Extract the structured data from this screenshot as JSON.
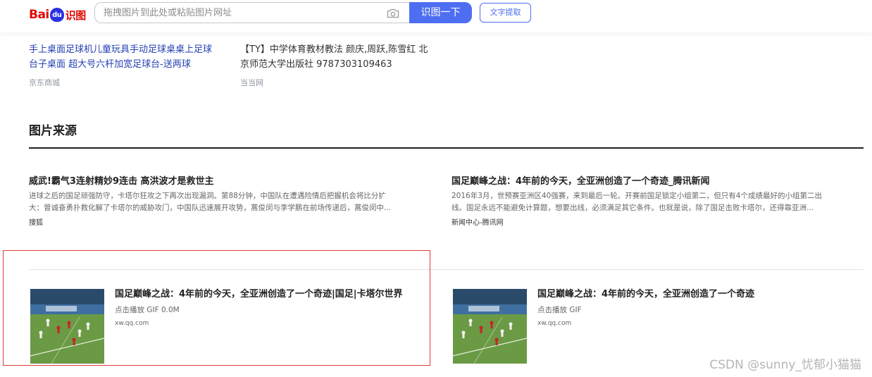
{
  "header": {
    "logo_bai": "Bai",
    "logo_du": "du",
    "logo_shitu": "识图",
    "search_placeholder": "拖拽图片到此处或粘贴图片网址",
    "search_button": "识图一下",
    "ocr_button": "文字提取"
  },
  "shopping": [
    {
      "title_line1": "手上桌面足球机儿童玩具手动足球桌桌上足球",
      "title_line2": "台子桌面 超大号六杆加宽足球台-送两球",
      "source": "京东商城"
    },
    {
      "title_line1": "【TY】中学体育教材教法 颜庆,周跃,陈雪红 北",
      "title_line2": "京师范大学出版社 9787303109463",
      "source": "当当网"
    }
  ],
  "section": {
    "title": "图片来源"
  },
  "text_results": [
    {
      "title": "威武!霸气3连射精妙9连击 高洪波才是救世主",
      "desc_line1": "进球之后的国足顽强防守，卡塔尔狂攻之下再次出现漏洞。第88分钟，中国队在遭遇险情后把握机会将比分扩",
      "desc_line2": "大：曾诚奋勇扑救化解了卡塔尔的威胁攻门，中国队迅速展开攻势，蒿俊闵与李学鹏在前场传递后，蒿俊闵中...",
      "source": "搜狐"
    },
    {
      "title": "国足巅峰之战：4年前的今天，全亚洲创造了一个奇迹_腾讯新闻",
      "desc_line1": "2016年3月，世预赛亚洲区40强赛，来到最后一轮。开赛前国足锁定小组第二，但只有4个成绩最好的小组第二出",
      "desc_line2": "线。国足永远不能避免计算题，想要出线，必须满足其它条件。也就是说，除了国足击败卡塔尔，还得靠亚洲...",
      "source": "新闻中心-腾讯网"
    }
  ],
  "image_results": [
    {
      "title": "国足巅峰之战：4年前的今天，全亚洲创造了一个奇迹|国足|卡塔尔世界",
      "meta": "点击播放 GIF 0.0M",
      "source": "xw.qq.com"
    },
    {
      "title": "国足巅峰之战：4年前的今天，全亚洲创造了一个奇迹",
      "meta": "点击播放 GIF",
      "source": "xw.qq.com"
    }
  ],
  "watermark": "CSDN @sunny_忧郁小猫猫",
  "colors": {
    "accent": "#4e6ef2",
    "logo_red": "#e10602",
    "link": "#2440b3",
    "highlight_frame": "#e23a3a"
  }
}
